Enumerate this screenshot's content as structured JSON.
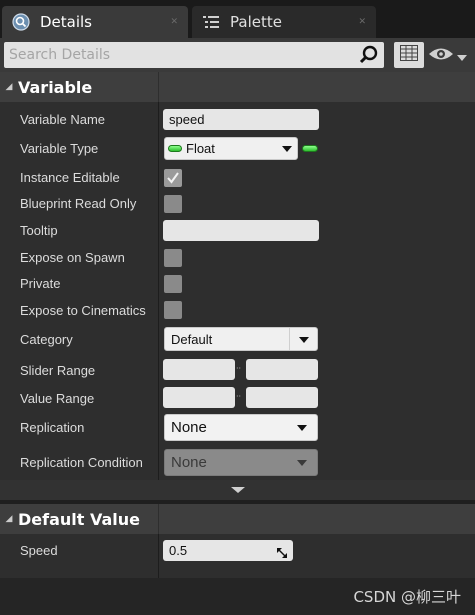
{
  "tabs": [
    {
      "label": "Details",
      "icon": "details-magnifier-icon",
      "active": true
    },
    {
      "label": "Palette",
      "icon": "palette-list-icon",
      "active": false
    }
  ],
  "search": {
    "placeholder": "Search Details"
  },
  "categories": {
    "variable": "Variable",
    "default_value": "Default Value"
  },
  "rows": {
    "variable_name": {
      "label": "Variable Name",
      "value": "speed"
    },
    "variable_type": {
      "label": "Variable Type",
      "value": "Float"
    },
    "instance_editable": {
      "label": "Instance Editable",
      "checked": true
    },
    "blueprint_read_only": {
      "label": "Blueprint Read Only",
      "checked": false
    },
    "tooltip": {
      "label": "Tooltip",
      "value": ""
    },
    "expose_on_spawn": {
      "label": "Expose on Spawn",
      "checked": false
    },
    "private": {
      "label": "Private",
      "checked": false
    },
    "expose_to_cinematics": {
      "label": "Expose to Cinematics",
      "checked": false
    },
    "category": {
      "label": "Category",
      "value": "Default"
    },
    "slider_range": {
      "label": "Slider Range",
      "min": "",
      "max": ""
    },
    "value_range": {
      "label": "Value Range",
      "min": "",
      "max": ""
    },
    "replication": {
      "label": "Replication",
      "value": "None"
    },
    "replication_condition": {
      "label": "Replication Condition",
      "value": "None"
    },
    "speed": {
      "label": "Speed",
      "value": "0.5"
    }
  },
  "colors": {
    "float_pin": "#4fe04f",
    "panel_bg": "#2e2e2e",
    "header_bg": "#3e3e3e"
  },
  "watermark": "CSDN @柳三叶"
}
